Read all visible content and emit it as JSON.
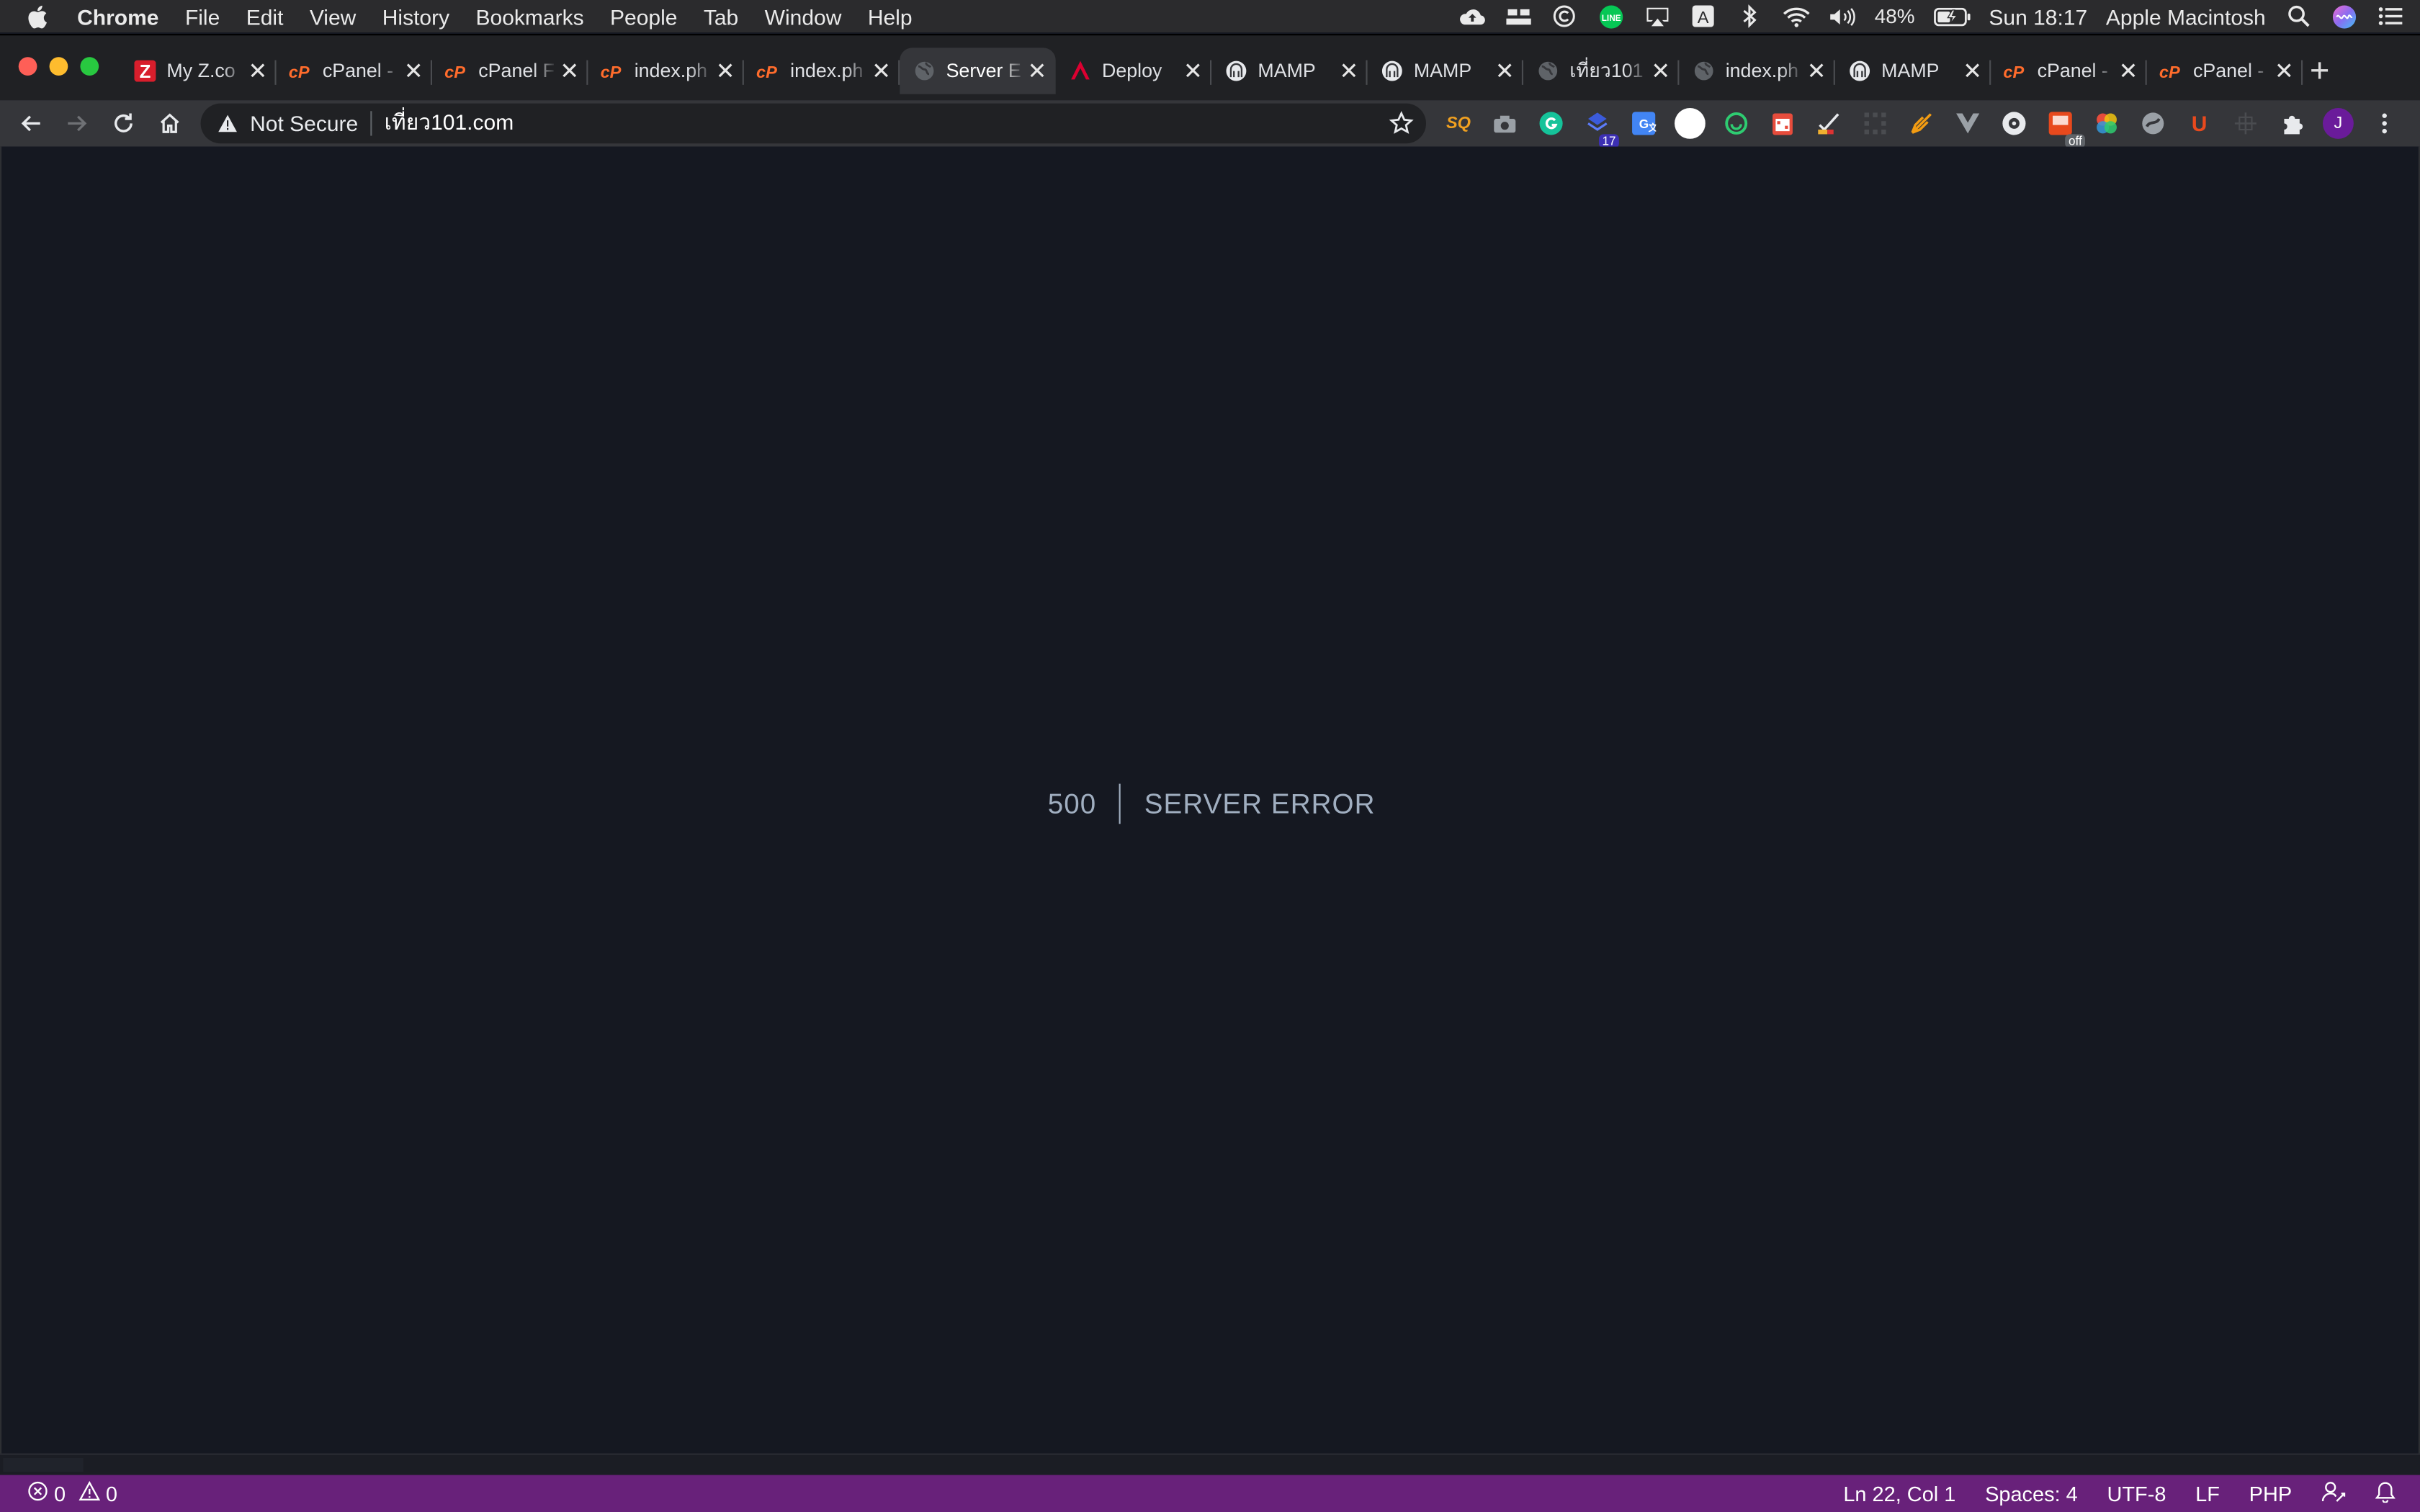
{
  "menubar": {
    "app": "Chrome",
    "items": [
      "File",
      "Edit",
      "View",
      "History",
      "Bookmarks",
      "People",
      "Tab",
      "Window",
      "Help"
    ],
    "battery": "48%",
    "clock": "Sun 18:17",
    "user": "Apple Macintosh"
  },
  "tabs": [
    {
      "title": "My Z.co",
      "favicon": "z-icon"
    },
    {
      "title": "cPanel -",
      "favicon": "cpanel-icon"
    },
    {
      "title": "cPanel F",
      "favicon": "cpanel-icon"
    },
    {
      "title": "index.ph",
      "favicon": "cpanel-icon"
    },
    {
      "title": "index.ph",
      "favicon": "cpanel-icon"
    },
    {
      "title": "Server E",
      "favicon": "globe-icon",
      "active": true
    },
    {
      "title": "Deploy",
      "favicon": "angular-icon"
    },
    {
      "title": "MAMP",
      "favicon": "mamp-icon"
    },
    {
      "title": "MAMP",
      "favicon": "mamp-icon"
    },
    {
      "title": "เที่ยว101",
      "favicon": "globe-icon"
    },
    {
      "title": "index.ph",
      "favicon": "globe-icon"
    },
    {
      "title": "MAMP",
      "favicon": "mamp-icon"
    },
    {
      "title": "cPanel -",
      "favicon": "cpanel-icon"
    },
    {
      "title": "cPanel -",
      "favicon": "cpanel-icon"
    }
  ],
  "omnibox": {
    "security_label": "Not Secure",
    "url": "เที่ยว101.com"
  },
  "extensions": {
    "badge_count": "17",
    "off_label": "off",
    "profile_initial": "J"
  },
  "page": {
    "error_code": "500",
    "error_message": "SERVER ERROR"
  },
  "statusbar": {
    "errors": "0",
    "warnings": "0",
    "position": "Ln 22, Col 1",
    "spaces": "Spaces: 4",
    "encoding": "UTF-8",
    "eol": "LF",
    "language": "PHP"
  },
  "colors": {
    "page_bg": "#151821",
    "error_text": "#a0aec0",
    "statusbar_bg": "#68217a",
    "cpanel_orange": "#ff6c2c"
  }
}
